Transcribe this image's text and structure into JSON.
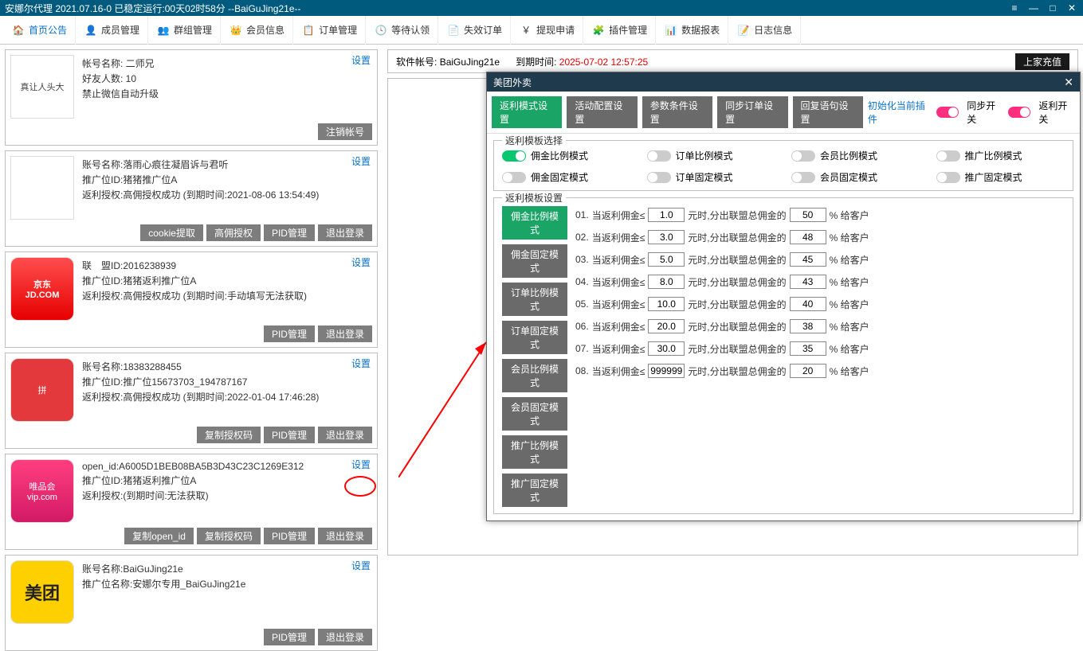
{
  "titlebar": {
    "text": "安娜尔代理   2021.07.16-0 已稳定运行:00天02时58分   --BaiGuJing21e--"
  },
  "menu": [
    {
      "label": "首页公告"
    },
    {
      "label": "成员管理"
    },
    {
      "label": "群组管理"
    },
    {
      "label": "会员信息"
    },
    {
      "label": "订单管理"
    },
    {
      "label": "等待认领"
    },
    {
      "label": "失效订单"
    },
    {
      "label": "提现申请"
    },
    {
      "label": "插件管理"
    },
    {
      "label": "数据报表"
    },
    {
      "label": "日志信息"
    }
  ],
  "topstrip": {
    "acct_label": "软件帐号:",
    "acct": "BaiGuJing21e",
    "exp_label": "到期时间:",
    "exp": "2025-07-02 12:57:25",
    "btn": "上家充值"
  },
  "common": {
    "settings": "设置"
  },
  "cards": [
    {
      "avatar_text": "真让人头大",
      "l1": "帐号名称: 二师兄",
      "l2": "好友人数: 10",
      "l3": "禁止微信自动升级",
      "btns": [
        "注销帐号"
      ]
    },
    {
      "avatar_text": "",
      "l1": "账号名称:落雨心痕往凝眉诉与君听",
      "l2": "推广位ID:猪猪推广位A",
      "l3": "返利授权:高佣授权成功 (到期时间:2021-08-06 13:54:49)",
      "btns": [
        "cookie提取",
        "高佣授权",
        "PID管理",
        "退出登录"
      ]
    },
    {
      "avatar_text": "京东\nJD.COM",
      "l1": "联　盟ID:2016238939",
      "l2": "推广位ID:猪猪返利推广位A",
      "l3": "返利授权:高佣授权成功 (到期时间:手动填写无法获取)",
      "btns": [
        "PID管理",
        "退出登录"
      ]
    },
    {
      "avatar_text": "拼",
      "l1": "账号名称:18383288455",
      "l2": "推广位ID:推广位15673703_194787167",
      "l3": "返利授权:高佣授权成功 (到期时间:2022-01-04 17:46:28)",
      "btns": [
        "复制授权码",
        "PID管理",
        "退出登录"
      ]
    },
    {
      "avatar_text": "唯品会\nvip.com",
      "l1": "open_id:A6005D1BEB08BA5B3D43C23C1269E312",
      "l2": "推广位ID:猪猪返利推广位A",
      "l3": "返利授权:(到期时间:无法获取)",
      "btns": [
        "复制open_id",
        "复制授权码",
        "PID管理",
        "退出登录"
      ]
    },
    {
      "avatar_text": "美团",
      "l1": "账号名称:BaiGuJing21e",
      "l2": "推广位名称:安娜尔专用_BaiGuJing21e",
      "l3": "",
      "btns": [
        "PID管理",
        "退出登录"
      ]
    }
  ],
  "dialog": {
    "title": "美团外卖",
    "tabs": [
      "返利模式设置",
      "活动配置设置",
      "参数条件设置",
      "同步订单设置",
      "回复语句设置"
    ],
    "init_link": "初始化当前插件",
    "switch1": "同步开关",
    "switch2": "返利开关",
    "fs1_title": "返利模板选择",
    "modes": [
      "佣金比例模式",
      "订单比例模式",
      "会员比例模式",
      "推广比例模式",
      "佣金固定模式",
      "订单固定模式",
      "会员固定模式",
      "推广固定模式"
    ],
    "fs2_title": "返利模板设置",
    "rule_btns": [
      "佣金比例模式",
      "佣金固定模式",
      "订单比例模式",
      "订单固定模式",
      "会员比例模式",
      "会员固定模式",
      "推广比例模式",
      "推广固定模式"
    ],
    "rule_prefix": "当返利佣金≤",
    "rule_mid": "元时,分出联盟总佣金的",
    "rule_suffix": "% 给客户",
    "rules": [
      {
        "n": "01.",
        "v1": "1.0",
        "v2": "50"
      },
      {
        "n": "02.",
        "v1": "3.0",
        "v2": "48"
      },
      {
        "n": "03.",
        "v1": "5.0",
        "v2": "45"
      },
      {
        "n": "04.",
        "v1": "8.0",
        "v2": "43"
      },
      {
        "n": "05.",
        "v1": "10.0",
        "v2": "40"
      },
      {
        "n": "06.",
        "v1": "20.0",
        "v2": "38"
      },
      {
        "n": "07.",
        "v1": "30.0",
        "v2": "35"
      },
      {
        "n": "08.",
        "v1": "999999",
        "v2": "20"
      }
    ]
  }
}
